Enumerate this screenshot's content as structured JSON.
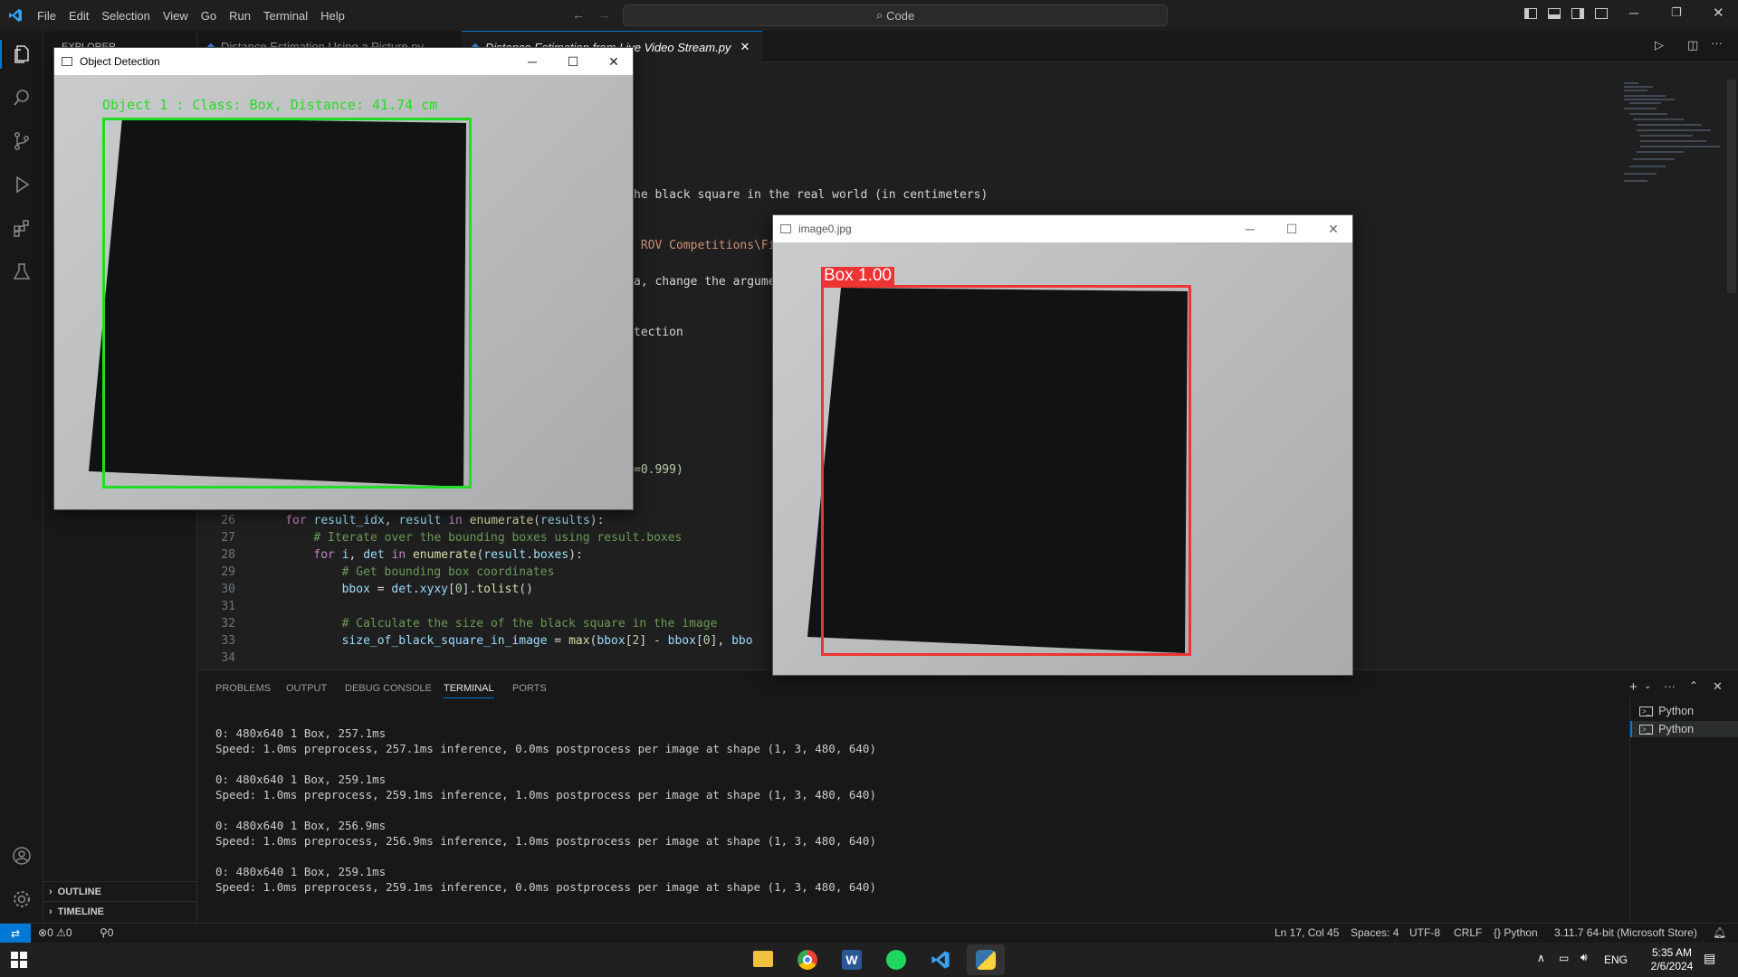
{
  "titlebar": {
    "menu": [
      "File",
      "Edit",
      "Selection",
      "View",
      "Go",
      "Run",
      "Terminal",
      "Help"
    ],
    "search": "Code"
  },
  "sidebar": {
    "header": "EXPLORER",
    "outline": "OUTLINE",
    "timeline": "TIMELINE"
  },
  "tabs": [
    {
      "label": "Distance Estimation Using a Picture.py",
      "active": false
    },
    {
      "label": "Distance Estimation from Live Video Stream.py",
      "active": true
    }
  ],
  "code_visible_fragments": {
    "line_a": "he black square in the real world (in centimeters)",
    "line_b": " ROV Competitions\\Fi",
    "line_c": "a, change the argume",
    "line_d": "tection",
    "line_e": "=0.999)"
  },
  "code": [
    {
      "n": "26",
      "indent": 4,
      "parts": [
        [
          "kw",
          "for "
        ],
        [
          "var",
          "result_idx"
        ],
        [
          "tx",
          ", "
        ],
        [
          "var",
          "result"
        ],
        [
          "kw",
          " in "
        ],
        [
          "fn",
          "enumerate"
        ],
        [
          "tx",
          "("
        ],
        [
          "var",
          "results"
        ],
        [
          "tx",
          "):"
        ]
      ]
    },
    {
      "n": "27",
      "indent": 8,
      "parts": [
        [
          "cm",
          "# Iterate over the bounding boxes using result.boxes"
        ]
      ]
    },
    {
      "n": "28",
      "indent": 8,
      "parts": [
        [
          "kw",
          "for "
        ],
        [
          "var",
          "i"
        ],
        [
          "tx",
          ", "
        ],
        [
          "var",
          "det"
        ],
        [
          "kw",
          " in "
        ],
        [
          "fn",
          "enumerate"
        ],
        [
          "tx",
          "("
        ],
        [
          "var",
          "result"
        ],
        [
          "tx",
          "."
        ],
        [
          "var",
          "boxes"
        ],
        [
          "tx",
          "):"
        ]
      ]
    },
    {
      "n": "29",
      "indent": 12,
      "parts": [
        [
          "cm",
          "# Get bounding box coordinates"
        ]
      ]
    },
    {
      "n": "30",
      "indent": 12,
      "parts": [
        [
          "var",
          "bbox"
        ],
        [
          "tx",
          " = "
        ],
        [
          "var",
          "det"
        ],
        [
          "tx",
          "."
        ],
        [
          "var",
          "xyxy"
        ],
        [
          "tx",
          "["
        ],
        [
          "num",
          "0"
        ],
        [
          "tx",
          "]."
        ],
        [
          "fn",
          "tolist"
        ],
        [
          "tx",
          "()"
        ]
      ]
    },
    {
      "n": "31",
      "indent": 0,
      "parts": []
    },
    {
      "n": "32",
      "indent": 12,
      "parts": [
        [
          "cm",
          "# Calculate the size of the black square in the image"
        ]
      ]
    },
    {
      "n": "33",
      "indent": 12,
      "parts": [
        [
          "var",
          "size_of_black_square_in_image"
        ],
        [
          "tx",
          " = "
        ],
        [
          "fn",
          "max"
        ],
        [
          "tx",
          "("
        ],
        [
          "var",
          "bbox"
        ],
        [
          "tx",
          "["
        ],
        [
          "num",
          "2"
        ],
        [
          "tx",
          "] - "
        ],
        [
          "var",
          "bbox"
        ],
        [
          "tx",
          "["
        ],
        [
          "num",
          "0"
        ],
        [
          "tx",
          "], "
        ],
        [
          "var",
          "bbo"
        ]
      ]
    },
    {
      "n": "34",
      "indent": 0,
      "parts": []
    }
  ],
  "panel": {
    "tabs": [
      "PROBLEMS",
      "OUTPUT",
      "DEBUG CONSOLE",
      "TERMINAL",
      "PORTS"
    ],
    "active_tab": "TERMINAL",
    "terminal_lines": [
      "0: 480x640 1 Box, 257.1ms",
      "Speed: 1.0ms preprocess, 257.1ms inference, 0.0ms postprocess per image at shape (1, 3, 480, 640)",
      "",
      "0: 480x640 1 Box, 259.1ms",
      "Speed: 1.0ms preprocess, 259.1ms inference, 1.0ms postprocess per image at shape (1, 3, 480, 640)",
      "",
      "0: 480x640 1 Box, 256.9ms",
      "Speed: 1.0ms preprocess, 256.9ms inference, 1.0ms postprocess per image at shape (1, 3, 480, 640)",
      "",
      "0: 480x640 1 Box, 259.1ms",
      "Speed: 1.0ms preprocess, 259.1ms inference, 0.0ms postprocess per image at shape (1, 3, 480, 640)"
    ],
    "terminals": [
      "Python",
      "Python"
    ]
  },
  "statusbar": {
    "errors": "0",
    "warnings": "0",
    "ports": "0",
    "position": "Ln 17, Col 45",
    "spaces": "Spaces: 4",
    "encoding": "UTF-8",
    "eol": "CRLF",
    "language": "Python",
    "interpreter": "3.11.7 64-bit (Microsoft Store)"
  },
  "taskbar": {
    "lang": "ENG",
    "time": "5:35 AM",
    "date": "2/6/2024"
  },
  "object_detection_window": {
    "title": "Object Detection",
    "overlay_label": "Object 1 : Class: Box, Distance: 41.74 cm",
    "box_color": "#22dd22"
  },
  "image_window": {
    "title": "image0.jpg",
    "box_label": "Box  1.00",
    "box_color": "#ee3333"
  },
  "colors": {
    "accent": "#0078d4",
    "bg": "#1f1f1f"
  }
}
